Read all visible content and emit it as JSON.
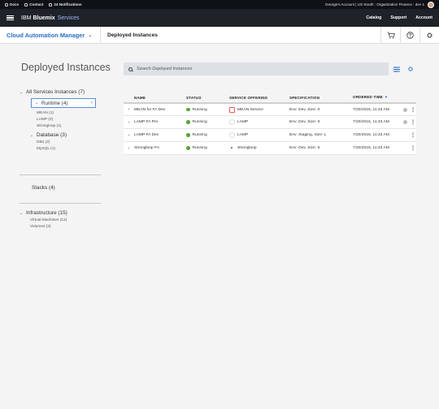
{
  "utility_bar": {
    "items": [
      "Docs",
      "Contact",
      "24 Notifications"
    ],
    "account_text": "George's Account | US South : Organization Finance : dev 1"
  },
  "header": {
    "ibm": "IBM",
    "bluemix": "Bluemix",
    "services": "Services",
    "nav": [
      "Catalog",
      "Support",
      "Account"
    ]
  },
  "subheader": {
    "product": "Cloud Automation Manager",
    "breadcrumb": "Deployed Instances",
    "icons": [
      "cart-icon",
      "help-icon",
      "settings-icon"
    ]
  },
  "left_panel": {
    "title": "Deployed Instances",
    "all_services": "All Services Instances (7)",
    "runtime": "Runtime (4)",
    "runtime_items": [
      "MEAN (1)",
      "LAMP (2)",
      "Strongloop (1)"
    ],
    "database": "Database (3)",
    "database_items": [
      "DB2 (2)",
      "MySQL (1)"
    ],
    "stacks": "Stacks (4)",
    "infrastructure": "Infrastructure (15)",
    "infrastructure_items": [
      "Virtual Machines (12)",
      "Volumes (3)"
    ]
  },
  "search": {
    "placeholder": "Search Deployed Instances"
  },
  "table": {
    "headers": [
      "NAME",
      "STATUS",
      "SERVICE OFFERING",
      "SPECIFICATION",
      "ORDERED TIME"
    ],
    "rows": [
      {
        "name": "MEAN for FA Dev",
        "status": "Running",
        "offering": "MEAN Service",
        "spec": "Env: Dev, Size: S",
        "time": "7/20/2016, 11:33 AM"
      },
      {
        "name": "LAMP FA Pro",
        "status": "Running",
        "offering": "LAMP",
        "spec": "Env: Dev, Size: S",
        "time": "7/20/2016, 11:33 AM"
      },
      {
        "name": "LAMP FA Dev",
        "status": "Running",
        "offering": "LAMP",
        "spec": "Env: Staging, Size: L",
        "time": "7/20/2016, 11:33 AM"
      },
      {
        "name": "Strongloop FA",
        "status": "Running",
        "offering": "Strongloop",
        "spec": "Env: Dev, Size: S",
        "time": "7/20/2016, 11:33 AM"
      }
    ]
  },
  "colors": {
    "running": "#5aa53b",
    "accent": "#2a6fc9",
    "header_bg": "#1d2329"
  }
}
